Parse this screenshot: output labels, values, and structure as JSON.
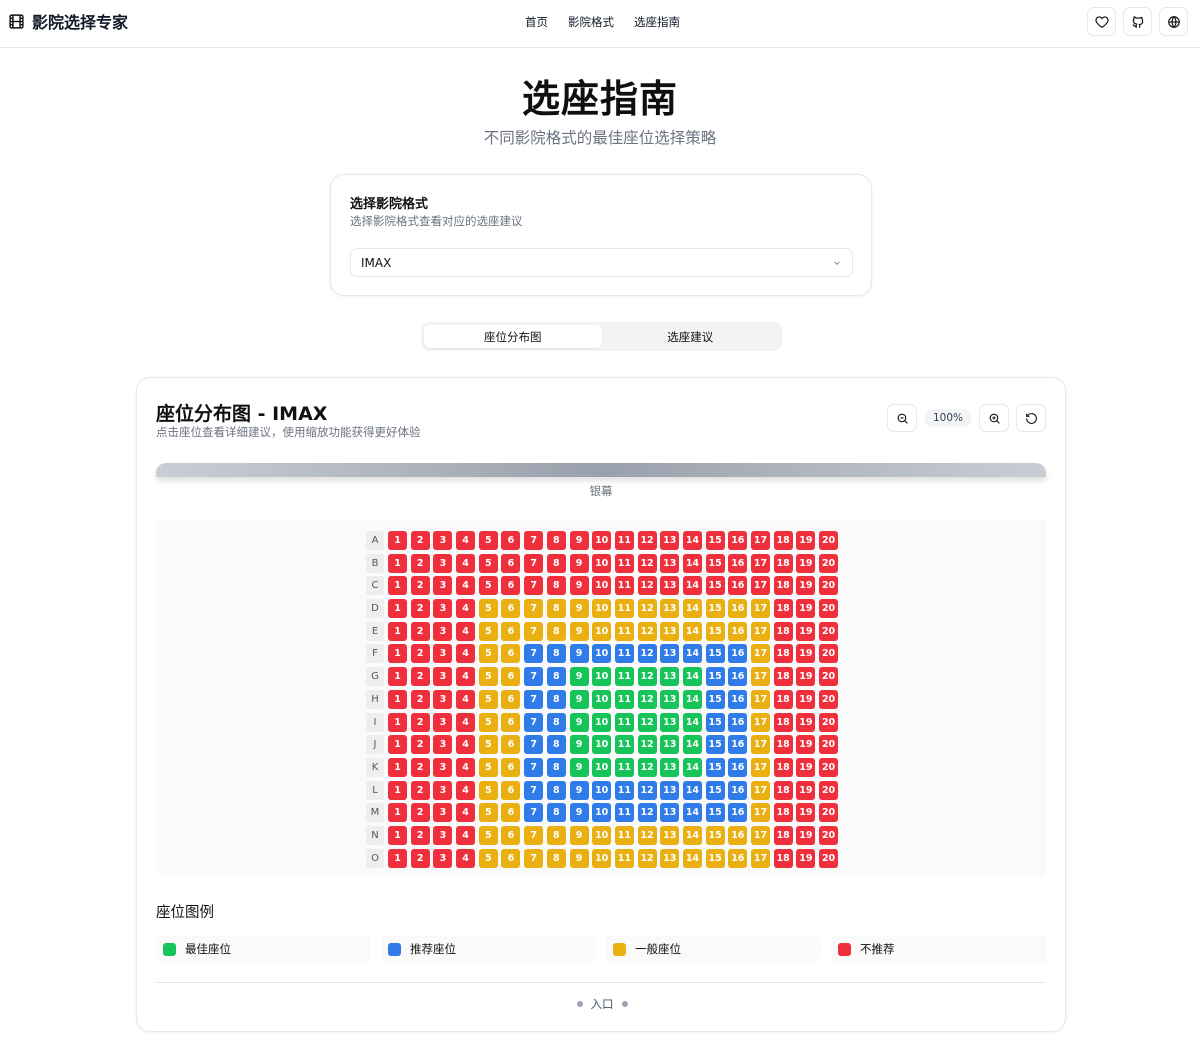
{
  "header": {
    "brand_title": "影院选择专家",
    "brand_icon": "film-icon",
    "nav": [
      "首页",
      "影院格式",
      "选座指南"
    ],
    "buttons": [
      "heart-icon",
      "github-icon",
      "globe-icon"
    ]
  },
  "hero": {
    "title": "选座指南",
    "subtitle": "不同影院格式的最佳座位选择策略"
  },
  "format_card": {
    "title": "选择影院格式",
    "description": "选择影院格式查看对应的选座建议",
    "selected": "IMAX"
  },
  "tabs": [
    {
      "label": "座位分布图",
      "active": true
    },
    {
      "label": "选座建议",
      "active": false
    }
  ],
  "seat_map": {
    "title": "座位分布图 - IMAX",
    "description": "点击座位查看详细建议，使用缩放功能获得更好体验",
    "zoom_level": "100%",
    "screen_label": "银幕",
    "rows": [
      "A",
      "B",
      "C",
      "D",
      "E",
      "F",
      "G",
      "H",
      "I",
      "J",
      "K",
      "L",
      "M",
      "N",
      "O"
    ],
    "seats_per_row": 20,
    "layout": [
      "RRRRRRRRRRRRRRRRRRRR",
      "RRRRRRRRRRRRRRRRRRRR",
      "RRRRRRRRRRRRRRRRRRRR",
      "RRRRYYYYYYYYYYYYYRRR",
      "RRRRYYYYYYYYYYYYYRRR",
      "RRRRYYBBBBBBBBBBYRRR",
      "RRRRYYBBGGGGGGBBYRRR",
      "RRRRYYBBGGGGGGBBYRRR",
      "RRRRYYBBGGGGGGBBYRRR",
      "RRRRYYBBGGGGGGBBYRRR",
      "RRRRYYBBGGGGGGBBYRRR",
      "RRRRYYBBBBBBBBBBYRRR",
      "RRRRYYBBBBBBBBBBYRRR",
      "RRRRYYYYYYYYYYYYYRRR",
      "RRRRYYYYYYYYYYYYYRRR"
    ],
    "layout_key": {
      "G": "best",
      "B": "recommended",
      "Y": "general",
      "R": "not_recommended"
    }
  },
  "legend": {
    "title": "座位图例",
    "items": [
      {
        "label": "最佳座位",
        "color": "#16c45a"
      },
      {
        "label": "推荐座位",
        "color": "#2f7be8"
      },
      {
        "label": "一般座位",
        "color": "#eab012"
      },
      {
        "label": "不推荐",
        "color": "#ef2f3c"
      }
    ]
  },
  "entrance_label": "入口"
}
